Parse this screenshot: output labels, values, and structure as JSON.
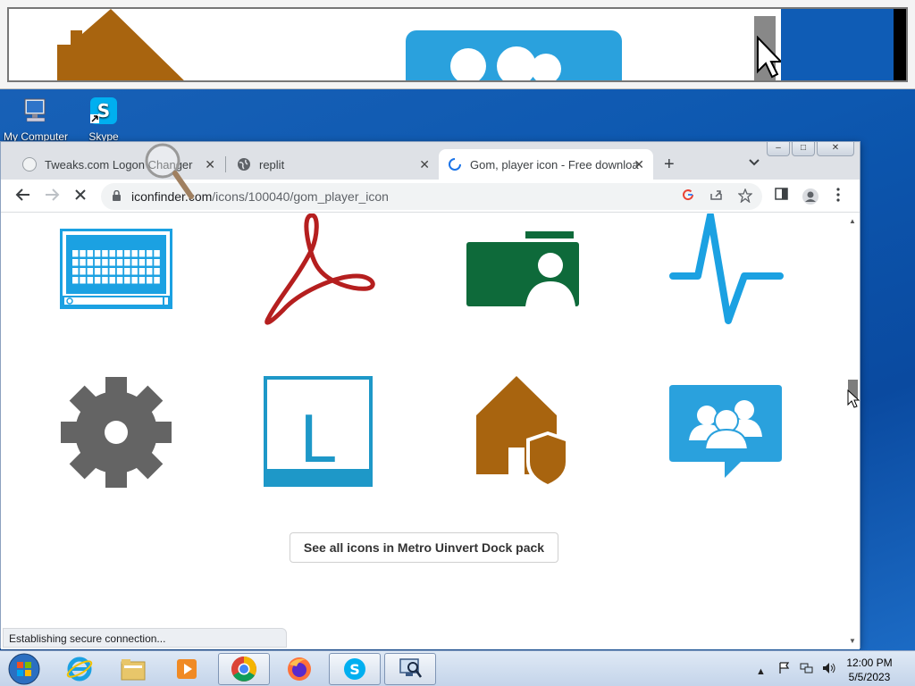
{
  "desktop": {
    "icons": [
      {
        "label": "My Computer",
        "icon": "computer-icon"
      },
      {
        "label": "Skype",
        "icon": "skype-icon"
      }
    ]
  },
  "browser": {
    "tabs": [
      {
        "title": "Tweaks.com Logon Changer",
        "icon": "page-icon",
        "active": false
      },
      {
        "title": "replit",
        "icon": "globe-icon",
        "active": false
      },
      {
        "title": "Gom, player icon - Free downloa",
        "icon": "loading-spinner-icon",
        "active": true
      }
    ],
    "new_tab": "+",
    "tab_menu": "⌄",
    "url_host": "iconfinder.com",
    "url_path": "/icons/100040/gom_player_icon",
    "status": "Establishing secure connection...",
    "pack_button": "See all icons in Metro Uinvert Dock pack",
    "window_controls": [
      "–",
      "□",
      "✕"
    ]
  },
  "icons_grid": [
    {
      "name": "keyboard-icon",
      "color": "#1ba1e2"
    },
    {
      "name": "acrobat-icon",
      "color": "#b51f1f"
    },
    {
      "name": "contact-card-icon",
      "color": "#0e6a3a"
    },
    {
      "name": "pulse-icon",
      "color": "#1ba1e2"
    },
    {
      "name": "gear-icon",
      "color": "#646464"
    },
    {
      "name": "lync-icon",
      "color": "#1e98c8"
    },
    {
      "name": "home-security-icon",
      "color": "#a8640f"
    },
    {
      "name": "group-chat-icon",
      "color": "#2aa1dd"
    }
  ],
  "taskbar": {
    "clock_time": "12:00 PM",
    "clock_date": "5/5/2023",
    "apps": [
      "start-orb",
      "internet-explorer",
      "file-explorer",
      "media-player",
      "chrome",
      "firefox",
      "skype",
      "remote-desktop"
    ]
  }
}
